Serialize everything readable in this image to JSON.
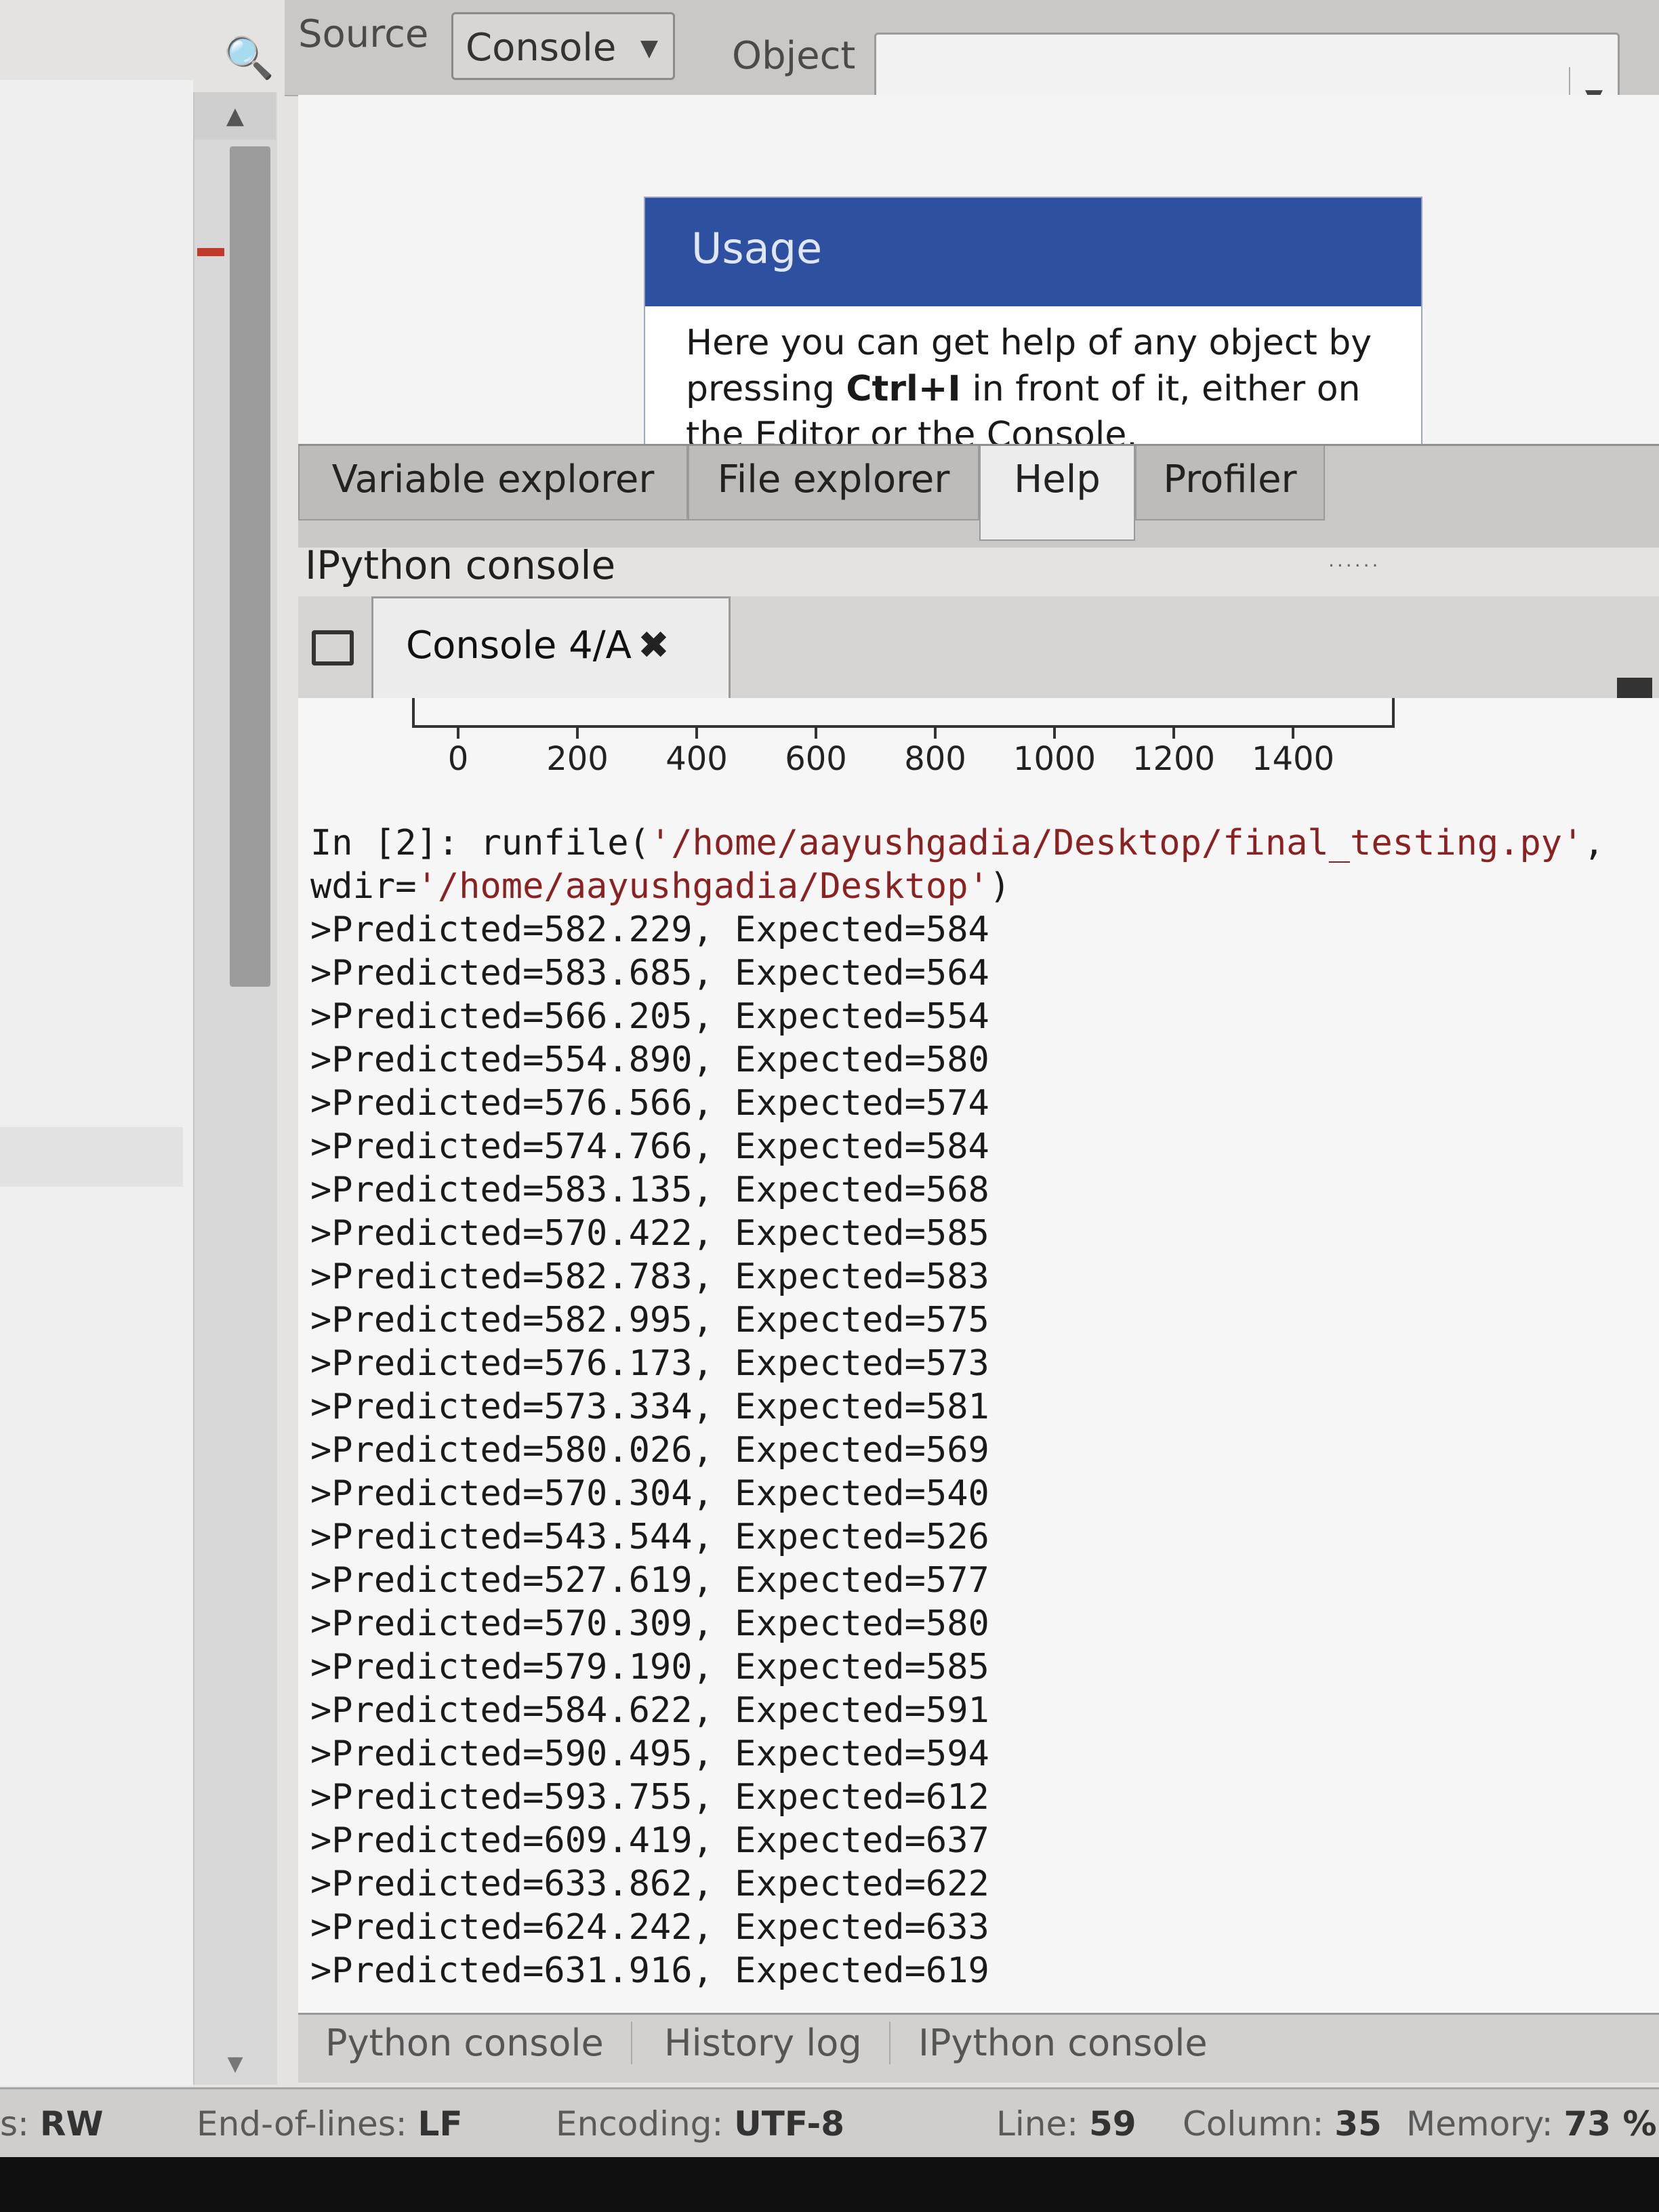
{
  "help_toolbar": {
    "source_label": "Source",
    "source_value": "Console",
    "object_label": "Object",
    "object_value": ""
  },
  "help": {
    "usage_title": "Usage",
    "usage_text_1": "Here you can get help of any object by pressing",
    "usage_shortcut": "Ctrl+I",
    "usage_text_2": "in front of it, either on the Editor or the Console."
  },
  "pane_tabs": [
    "Variable explorer",
    "File explorer",
    "Help",
    "Profiler"
  ],
  "pane_grip": "......",
  "ipython": {
    "title": "IPython console",
    "console_tab": "Console 4/A",
    "close_glyph": "✖"
  },
  "plot_axis": {
    "ticks": [
      "0",
      "200",
      "400",
      "600",
      "800",
      "1000",
      "1200",
      "1400"
    ]
  },
  "console": {
    "in_prompt": "In [2]:",
    "command_fn": "runfile(",
    "command_arg1": "'/home/aayushgadia/Desktop/final_testing.py'",
    "command_sep": ",",
    "wdir_prefix": "wdir=",
    "command_arg2": "'/home/aayushgadia/Desktop'",
    "command_close": ")",
    "output": [
      ">Predicted=582.229, Expected=584",
      ">Predicted=583.685, Expected=564",
      ">Predicted=566.205, Expected=554",
      ">Predicted=554.890, Expected=580",
      ">Predicted=576.566, Expected=574",
      ">Predicted=574.766, Expected=584",
      ">Predicted=583.135, Expected=568",
      ">Predicted=570.422, Expected=585",
      ">Predicted=582.783, Expected=583",
      ">Predicted=582.995, Expected=575",
      ">Predicted=576.173, Expected=573",
      ">Predicted=573.334, Expected=581",
      ">Predicted=580.026, Expected=569",
      ">Predicted=570.304, Expected=540",
      ">Predicted=543.544, Expected=526",
      ">Predicted=527.619, Expected=577",
      ">Predicted=570.309, Expected=580",
      ">Predicted=579.190, Expected=585",
      ">Predicted=584.622, Expected=591",
      ">Predicted=590.495, Expected=594",
      ">Predicted=593.755, Expected=612",
      ">Predicted=609.419, Expected=637",
      ">Predicted=633.862, Expected=622",
      ">Predicted=624.242, Expected=633",
      ">Predicted=631.916, Expected=619"
    ]
  },
  "bottom_tabs": [
    "Python console",
    "History log",
    "IPython console"
  ],
  "status": {
    "permissions_label": "s:",
    "permissions_value": "RW",
    "eol_label": "End-of-lines:",
    "eol_value": "LF",
    "encoding_label": "Encoding:",
    "encoding_value": "UTF-8",
    "line_label": "Line:",
    "line_value": "59",
    "column_label": "Column:",
    "column_value": "35",
    "memory_label": "Memory:",
    "memory_value": "73 %"
  },
  "icons": {
    "scroll_up": "▲",
    "scroll_down": "▼",
    "dropdown": "▼",
    "search": "🔍"
  }
}
